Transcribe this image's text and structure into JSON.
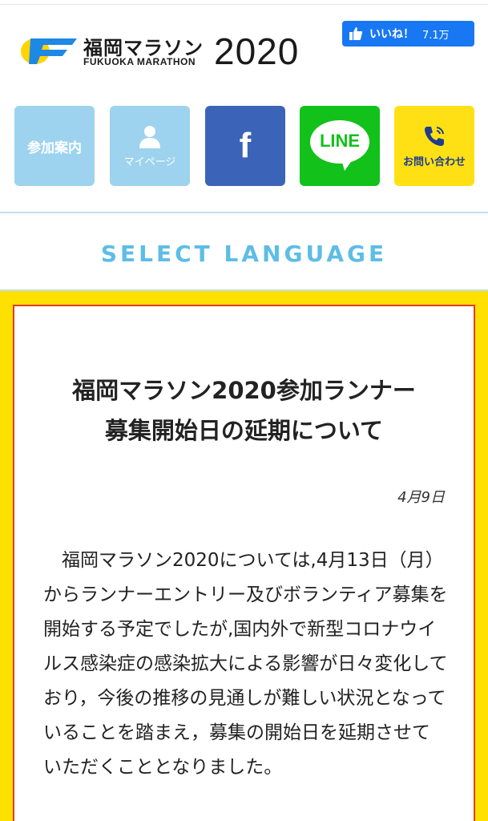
{
  "header": {
    "logo_jp": "福岡マラソン",
    "logo_en": "FUKUOKA MARATHON",
    "logo_year": "2020",
    "like_label": "いいね！",
    "like_count": "7.1万"
  },
  "nav": {
    "guide_label": "参加案内",
    "mypage_label": "マイページ",
    "facebook_icon": "f",
    "line_label": "LINE",
    "contact_label": "お問い合わせ"
  },
  "language": {
    "label": "SELECT LANGUAGE"
  },
  "notice": {
    "title_line1": "福岡マラソン2020参加ランナー",
    "title_line2": "募集開始日の延期について",
    "date": "4月9日",
    "body": "福岡マラソン2020については,4月13日（月）からランナーエントリー及びボランティア募集を開始する予定でしたが,国内外で新型コロナウイルス感染症の感染拡大による影響が日々変化しており，今後の推移の見通しが難しい状況となっていることを踏まえ，募集の開始日を延期させていただくこととなりました。"
  },
  "colors": {
    "facebook_blue": "#3b64b8",
    "line_green": "#12c11a",
    "light_blue": "#9dd3ee",
    "yellow": "#ffe000",
    "frame_red": "#e53a2a",
    "select_language_blue": "#5dbde6"
  }
}
